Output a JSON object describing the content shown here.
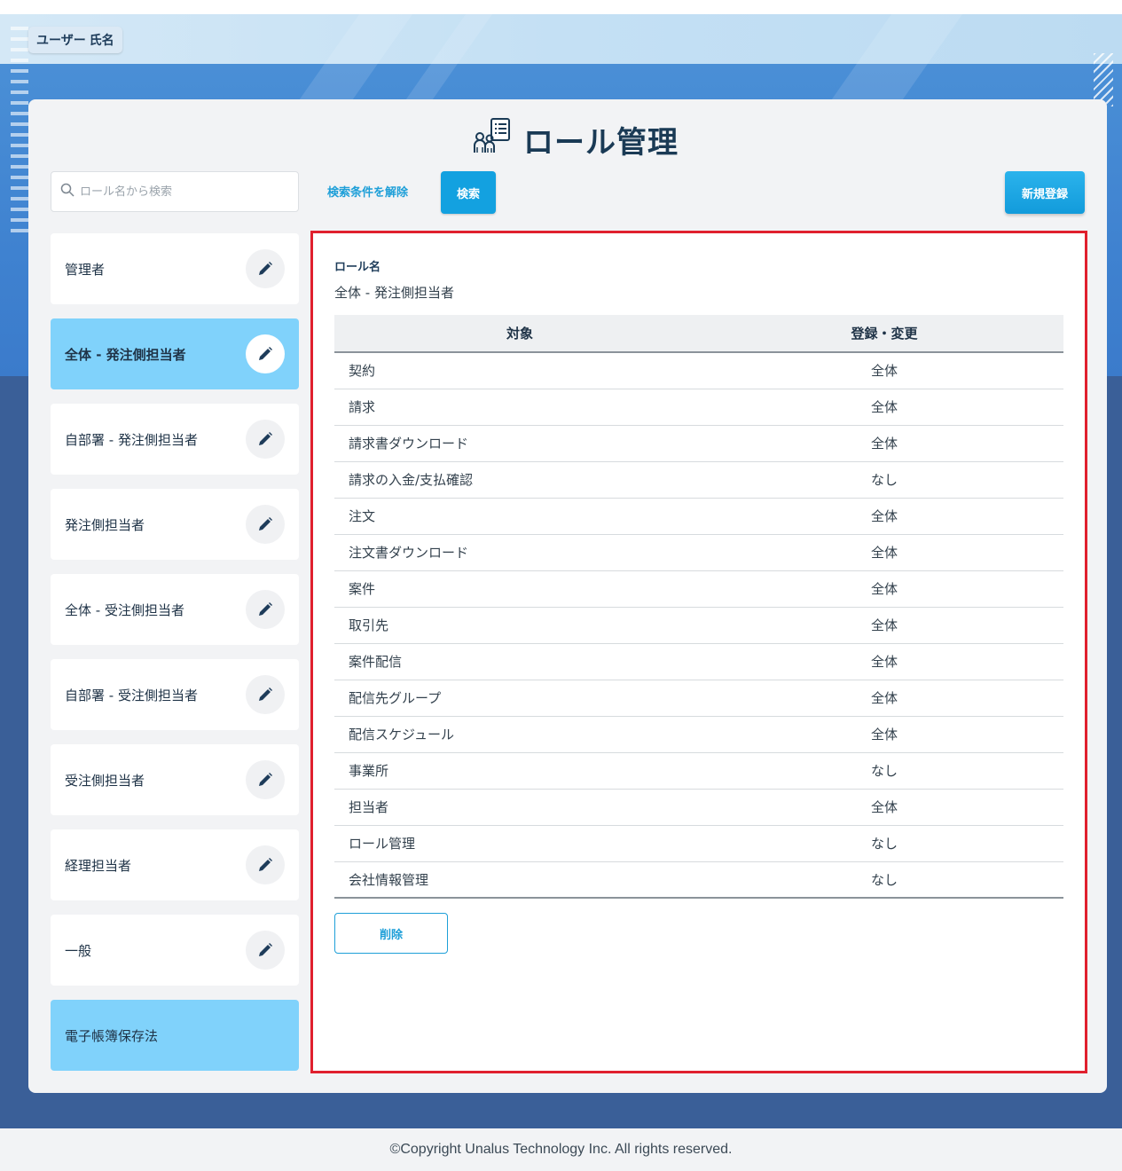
{
  "header": {
    "user_name": "ユーザー 氏名"
  },
  "page": {
    "title": "ロール管理",
    "title_icon": "role-management-icon"
  },
  "search": {
    "placeholder": "ロール名から検索",
    "value": "",
    "clear_label": "検索条件を解除",
    "search_label": "検索",
    "new_label": "新規登録"
  },
  "roles": [
    {
      "label": "管理者",
      "selected": false,
      "editable": true
    },
    {
      "label": "全体 - 発注側担当者",
      "selected": true,
      "editable": true
    },
    {
      "label": "自部署 - 発注側担当者",
      "selected": false,
      "editable": true
    },
    {
      "label": "発注側担当者",
      "selected": false,
      "editable": true
    },
    {
      "label": "全体 - 受注側担当者",
      "selected": false,
      "editable": true
    },
    {
      "label": "自部署 - 受注側担当者",
      "selected": false,
      "editable": true
    },
    {
      "label": "受注側担当者",
      "selected": false,
      "editable": true
    },
    {
      "label": "経理担当者",
      "selected": false,
      "editable": true
    },
    {
      "label": "一般",
      "selected": false,
      "editable": true
    },
    {
      "label": "電子帳簿保存法",
      "selected": false,
      "editable": false
    }
  ],
  "detail": {
    "role_name_label": "ロール名",
    "role_name_value": "全体 - 発注側担当者",
    "columns": [
      "対象",
      "登録・変更"
    ],
    "rows": [
      {
        "target": "契約",
        "value": "全体"
      },
      {
        "target": "請求",
        "value": "全体"
      },
      {
        "target": "請求書ダウンロード",
        "value": "全体"
      },
      {
        "target": "請求の入金/支払確認",
        "value": "なし"
      },
      {
        "target": "注文",
        "value": "全体"
      },
      {
        "target": "注文書ダウンロード",
        "value": "全体"
      },
      {
        "target": "案件",
        "value": "全体"
      },
      {
        "target": "取引先",
        "value": "全体"
      },
      {
        "target": "案件配信",
        "value": "全体"
      },
      {
        "target": "配信先グループ",
        "value": "全体"
      },
      {
        "target": "配信スケジュール",
        "value": "全体"
      },
      {
        "target": "事業所",
        "value": "なし"
      },
      {
        "target": "担当者",
        "value": "全体"
      },
      {
        "target": "ロール管理",
        "value": "なし"
      },
      {
        "target": "会社情報管理",
        "value": "なし"
      }
    ],
    "delete_label": "削除"
  },
  "footer": {
    "copyright": "©Copyright Unalus Technology Inc. All rights reserved."
  },
  "colors": {
    "accent": "#13a1e0",
    "selected_row": "#80d2fb",
    "highlight_border": "#e0202e",
    "title": "#1a3a55"
  }
}
